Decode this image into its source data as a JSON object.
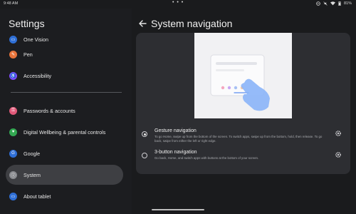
{
  "status_bar": {
    "time": "9:48 AM",
    "battery": "81%"
  },
  "settings_list": {
    "title": "Settings",
    "items": [
      {
        "label": "One Vision",
        "icon": "one-vision-icon",
        "color": "#2f6fd6"
      },
      {
        "label": "Pen",
        "icon": "pen-icon",
        "color": "#e8743b"
      },
      {
        "label": "Accessibility",
        "icon": "accessibility-icon",
        "color": "#7c4dff"
      },
      {
        "label": "Passwords & accounts",
        "icon": "key-icon",
        "color": "#e15a7a"
      },
      {
        "label": "Digital Wellbeing & parental controls",
        "icon": "wellbeing-icon",
        "color": "#33a852"
      },
      {
        "label": "Google",
        "icon": "google-icon",
        "color": "#2f6fd6"
      },
      {
        "label": "System",
        "icon": "system-icon",
        "color": "#8a8c90"
      },
      {
        "label": "About tablet",
        "icon": "tablet-icon",
        "color": "#2f6fd6"
      }
    ],
    "selected": "System"
  },
  "detail": {
    "title": "System navigation",
    "options": [
      {
        "title": "Gesture navigation",
        "description": "To go Home, swipe up from the bottom of the screen. To switch apps, swipe up from the bottom, hold, then release. To go back, swipe from either the left or right edge.",
        "selected": true
      },
      {
        "title": "3-button navigation",
        "description": "Go back, Home, and switch apps with buttons at the bottom of your screen.",
        "selected": false
      }
    ]
  },
  "colors": {
    "background": "#1a1b1d",
    "card": "#2d2e32",
    "selected_item": "#3e3f43",
    "illustration_bg": "#f1f1f3",
    "hand": "#8ab4f8"
  }
}
